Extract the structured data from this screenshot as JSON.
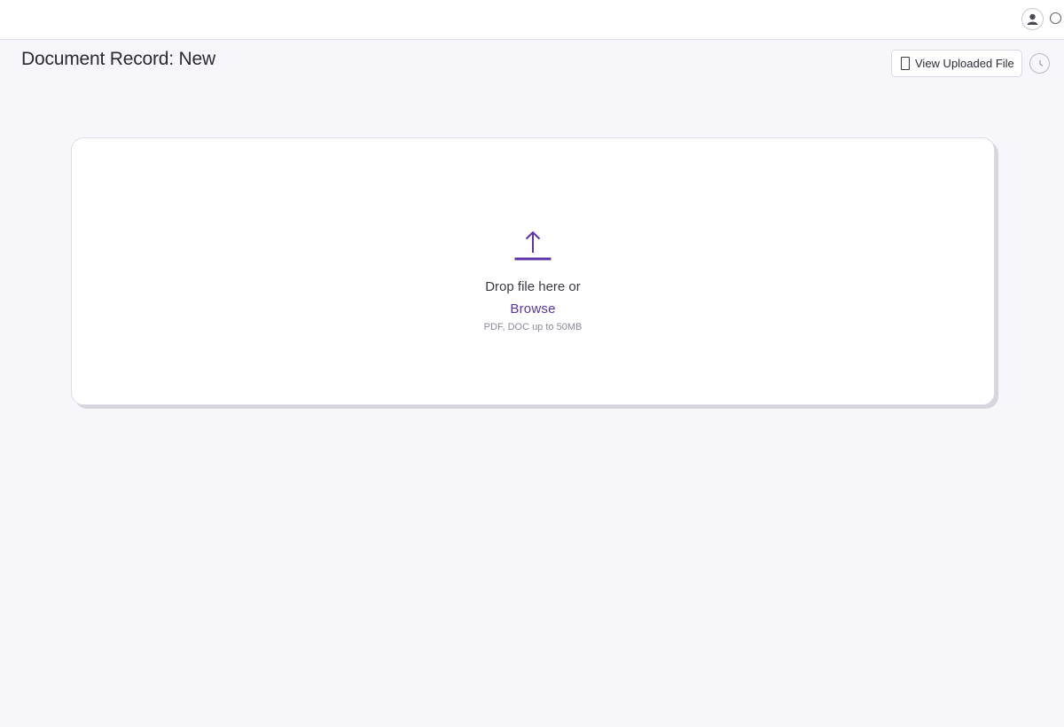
{
  "header": {
    "avatar_icon": "user-avatar-icon",
    "status_icon": "loading-spinner-icon"
  },
  "page": {
    "title": "Document Record: New"
  },
  "toolbar": {
    "view_file_label": "View Uploaded File",
    "view_file_icon": "document-icon",
    "history_icon": "clock-icon"
  },
  "dropzone": {
    "icon": "upload-arrow-icon",
    "drop_text": "Drop file here or",
    "browse_label": "Browse",
    "hint": "PDF, DOC up to 50MB",
    "accent_color": "#5b34a6"
  }
}
